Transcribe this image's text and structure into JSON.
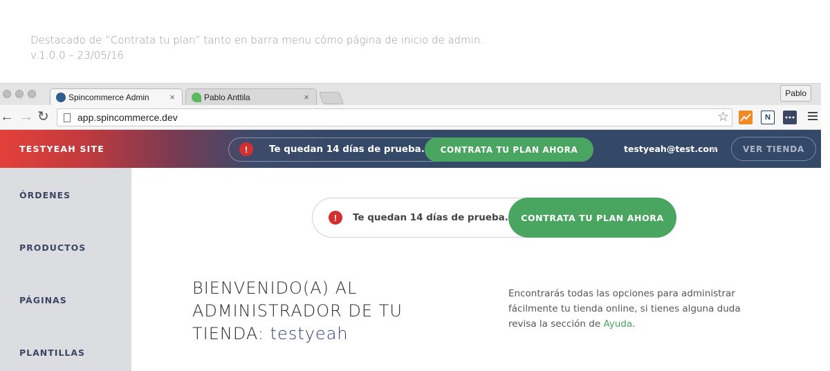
{
  "caption": {
    "line1": "Destacado de ”Contrata tu plan” tanto en barra menu cómo página de inicio de admin.",
    "line2": "v.1.0.0 – 23/05/16"
  },
  "browser": {
    "tabs": [
      {
        "title": "Spincommerce Admin",
        "active": true,
        "favicon": "spincommerce-logo-icon"
      },
      {
        "title": "Pablo Anttila",
        "active": false,
        "favicon": "leaf-icon"
      }
    ],
    "tab_close": "×",
    "profile": "Pablo",
    "url": "app.spincommerce.dev",
    "icons": {
      "back": "←",
      "forward": "→",
      "reload": "↻",
      "star": "☆",
      "ext_n": "N"
    }
  },
  "header": {
    "brand": "TESTYEAH SITE",
    "trial_text": "Te quedan 14 días de prueba.",
    "cta": "CONTRATA TU PLAN AHORA",
    "user_email": "testyeah@test.com",
    "view_store": "VER TIENDA",
    "alert_glyph": "!"
  },
  "sidebar": {
    "items": [
      {
        "label": "ÓRDENES"
      },
      {
        "label": "PRODUCTOS"
      },
      {
        "label": "PÁGINAS"
      },
      {
        "label": "PLANTILLAS"
      }
    ]
  },
  "main": {
    "trial_text": "Te quedan 14 días de prueba.",
    "cta": "CONTRATA TU PLAN AHORA",
    "alert_glyph": "!",
    "welcome_line1": "BIENVENIDO(A) AL",
    "welcome_line2": "ADMINISTRADOR DE TU",
    "welcome_line3": "TIENDA:",
    "store_name": "testyeah",
    "intro_before": "Encontrarás todas las opciones para administrar fácilmente tu tienda online, si tienes alguna duda revisa la sección de",
    "help_link": "Ayuda",
    "intro_after": "."
  },
  "colors": {
    "header_bg": "#344868",
    "brand_red": "#e4403a",
    "cta_green": "#4aa561",
    "sidebar_bg": "#dcdde1",
    "alert_red": "#d32f2f",
    "store_name_blue": "#2d3a7c"
  }
}
